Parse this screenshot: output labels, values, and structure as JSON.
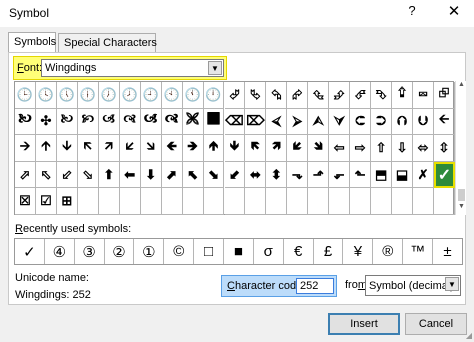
{
  "window": {
    "title": "Symbol",
    "help_label": "?",
    "close_label": "✕"
  },
  "tabs": [
    {
      "label": "Symbols"
    },
    {
      "label": "Special Characters"
    }
  ],
  "font": {
    "label_prefix": "F",
    "label_rest": "ont:",
    "value": "Wingdings"
  },
  "grid_rows": [
    [
      "🕒",
      "🕓",
      "🕔",
      "🕕",
      "🕖",
      "🕗",
      "🕘",
      "🕙",
      "🕚",
      "🕛",
      "⮰",
      "⮱",
      "⮲",
      "⮳",
      "⮴",
      "⮵",
      "⮶",
      "⮷",
      "⮸",
      "⮹",
      "⮺"
    ],
    [
      "🙤",
      "✣",
      "🙠",
      "🙡",
      "🙢",
      "🙣",
      "🙦",
      "🙧",
      "🙨",
      "🙩",
      "⌫",
      "⌦",
      "⮘",
      "⮚",
      "⮙",
      "⮛",
      "⮈",
      "⮊",
      "⮉",
      "⮋",
      "🡨"
    ],
    [
      "🡪",
      "🡩",
      "🡫",
      "🡬",
      "🡭",
      "🡯",
      "🡮",
      "🡸",
      "🡺",
      "🡹",
      "🡻",
      "🡼",
      "🡽",
      "🡿",
      "🡾",
      "⇦",
      "⇨",
      "⇧",
      "⇩",
      "⬄",
      "⇳"
    ],
    [
      "⬀",
      "⬁",
      "⬃",
      "⬂",
      "⬆",
      "⬅",
      "⬇",
      "⬈",
      "⬉",
      "⬊",
      "⬋",
      "⬌",
      "⬍",
      "⬎",
      "⬏",
      "⬐",
      "⬑",
      "⬒",
      "⬓",
      "✗",
      "✓"
    ],
    [
      "☒",
      "☑",
      "⊞",
      "",
      "",
      "",
      "",
      "",
      "",
      "",
      "",
      "",
      "",
      "",
      "",
      "",
      "",
      "",
      "",
      "",
      ""
    ]
  ],
  "recent": {
    "label_prefix": "R",
    "label_rest": "ecently used symbols:",
    "symbols": [
      "✓",
      "④",
      "③",
      "②",
      "①",
      "©",
      "□",
      "■",
      "σ",
      "€",
      "£",
      "¥",
      "®",
      "™",
      "±"
    ]
  },
  "unicode": {
    "label": "Unicode name:",
    "value": "Wingdings: 252"
  },
  "charcode": {
    "label_prefix": "C",
    "label_rest": "haracter code:",
    "value": "252"
  },
  "from": {
    "label_prefix": "m",
    "label_before": "fro",
    "label_after": ":",
    "value": "Symbol (decimal)"
  },
  "buttons": {
    "insert": "Insert",
    "cancel": "Cancel"
  },
  "colors": {
    "highlight": "#ffff78",
    "selected": "#2e8b3a",
    "accent": "#3c7fb1"
  }
}
